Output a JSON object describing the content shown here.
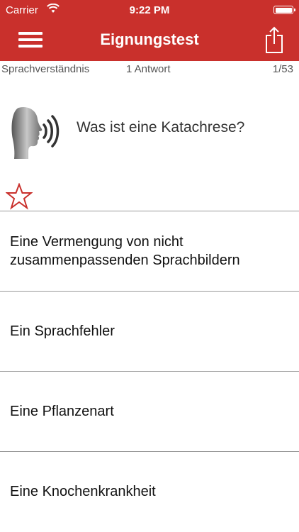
{
  "status_bar": {
    "carrier": "Carrier",
    "time": "9:22 PM"
  },
  "nav": {
    "title": "Eignungstest",
    "menu_icon": "hamburger-menu-icon",
    "share_icon": "share-icon"
  },
  "subheader": {
    "category": "Sprachverständnis",
    "answer_count": "1 Antwort",
    "progress": "1/53"
  },
  "question": {
    "text": "Was ist eine Katachrese?",
    "icon": "speaker-head-icon"
  },
  "favorite": {
    "icon": "star-outline-icon",
    "color": "#c9302c"
  },
  "answers": [
    {
      "label": "Eine Vermengung von nicht zusammenpassenden Sprachbildern"
    },
    {
      "label": "Ein Sprachfehler"
    },
    {
      "label": "Eine Pflanzenart"
    },
    {
      "label": "Eine Knochenkrankheit"
    }
  ],
  "colors": {
    "bar": "#c9302c",
    "divider": "#9a9a9a"
  }
}
